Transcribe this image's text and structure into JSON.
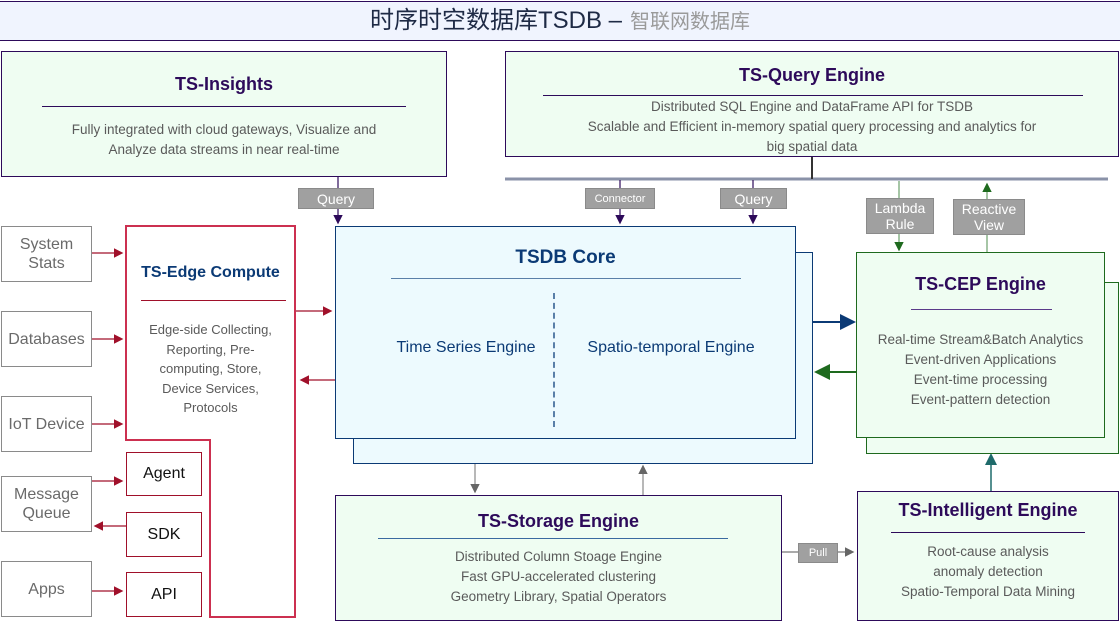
{
  "header": {
    "title": "时序时空数据库TSDB –",
    "subtitle": "智联网数据库"
  },
  "insights": {
    "title": "TS-Insights",
    "lines": [
      "Fully integrated with cloud gateways, Visualize and",
      "Analyze data streams in near real-time"
    ]
  },
  "query_engine": {
    "title": "TS-Query Engine",
    "lines": [
      "Distributed SQL Engine and DataFrame API for TSDB",
      "Scalable and Efficient in-memory spatial query processing and analytics for",
      "big spatial data"
    ]
  },
  "connector_tags": {
    "insights_query": "Query",
    "connector": "Connector",
    "core_query": "Query",
    "lambda_rule": [
      "Lambda",
      "Rule"
    ],
    "reactive_view": [
      "Reactive",
      "View"
    ],
    "pull": "Pull"
  },
  "sources": [
    {
      "label": [
        "System",
        "Stats"
      ]
    },
    {
      "label": [
        "Databases"
      ]
    },
    {
      "label": [
        "IoT Device"
      ]
    },
    {
      "label": [
        "Message",
        "Queue"
      ]
    },
    {
      "label": [
        "Apps"
      ]
    }
  ],
  "edge_compute": {
    "title": "TS-Edge Compute",
    "lines": [
      "Edge-side Collecting,",
      "Reporting, Pre-",
      "computing, Store,",
      "Device Services,",
      "Protocols"
    ]
  },
  "edge_components": [
    "Agent",
    "SDK",
    "API"
  ],
  "core": {
    "title": "TSDB Core",
    "left_engine": "Time Series Engine",
    "right_engine": "Spatio-temporal Engine"
  },
  "cep": {
    "title": "TS-CEP Engine",
    "lines": [
      "Real-time Stream&Batch Analytics",
      "Event-driven Applications",
      "Event-time processing",
      "Event-pattern detection"
    ]
  },
  "storage": {
    "title": "TS-Storage Engine",
    "lines": [
      "Distributed Column Stoage Engine",
      "Fast GPU-accelerated clustering",
      "Geometry Library, Spatial Operators"
    ]
  },
  "intelligent": {
    "title": "TS-Intelligent Engine",
    "lines": [
      "Root-cause analysis",
      "anomaly detection",
      "Spatio-Temporal Data Mining"
    ]
  },
  "colors": {
    "purple": "#2d0a5a",
    "navy": "#0b3a75",
    "edge_red": "#a0102a",
    "cep_green": "#1e6a1e",
    "teal": "#1e6a6a",
    "green_fill": "#effdf2",
    "core_fill": "#edfafe"
  }
}
